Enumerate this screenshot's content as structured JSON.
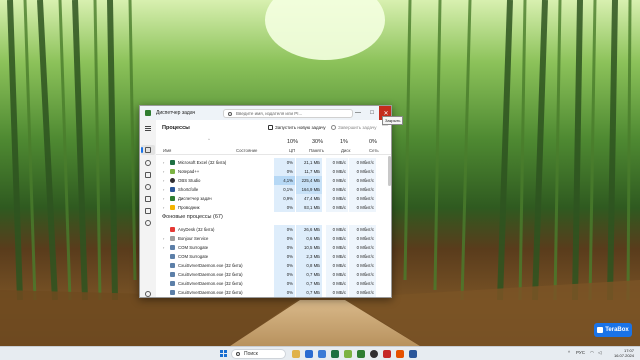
{
  "window": {
    "title": "Диспетчер задач",
    "search_placeholder": "Введите имя, издателя или PI...",
    "minimize": "—",
    "maximize": "□",
    "close": "✕",
    "close_tooltip": "Закрыть"
  },
  "toolbar": {
    "page_title": "Процессы",
    "run_task": "Запустить новую задачу",
    "end_task": "Завершить задачу",
    "more": "···"
  },
  "columns": {
    "name": "Имя",
    "status": "Состояние",
    "cpu_pct": "10%",
    "cpu": "ЦП",
    "mem_pct": "30%",
    "mem": "Память",
    "disk_pct": "1%",
    "disk": "Диск",
    "net_pct": "0%",
    "net": "Сеть"
  },
  "app_rows": [
    {
      "name": "Microsoft Excel (32 бита)",
      "cpu": "0%",
      "mem": "21,1 МБ",
      "disk": "0 МБ/с",
      "net": "0 Мбит/с",
      "icon_color": "#1d6f42"
    },
    {
      "name": "Notepad++",
      "cpu": "0%",
      "mem": "11,7 МБ",
      "disk": "0 МБ/с",
      "net": "0 Мбит/с",
      "icon_color": "#7cb342"
    },
    {
      "name": "OBS Studio",
      "cpu": "4,1%",
      "mem": "225,4 МБ",
      "disk": "0 МБ/с",
      "net": "0 Мбит/с",
      "icon_color": "#302e31"
    },
    {
      "name": "Shortcfolle",
      "cpu": "0,1%",
      "mem": "164,9 МБ",
      "disk": "0 МБ/с",
      "net": "0 Мбит/с",
      "icon_color": "#2b579a"
    },
    {
      "name": "Диспетчер задач",
      "cpu": "0,9%",
      "mem": "47,4 МБ",
      "disk": "0 МБ/с",
      "net": "0 Мбит/с",
      "icon_color": "#2e7d32"
    },
    {
      "name": "Проводник",
      "cpu": "0%",
      "mem": "93,1 МБ",
      "disk": "0 МБ/с",
      "net": "0 Мбит/с",
      "icon_color": "#f4b400"
    }
  ],
  "background_group": "Фоновые процессы (67)",
  "bg_rows": [
    {
      "name": "AnyDesk (32 бита)",
      "cpu": "0%",
      "mem": "26,6 МБ",
      "disk": "0 МБ/с",
      "net": "0 Мбит/с",
      "icon_color": "#e53935"
    },
    {
      "name": "Bonjour Service",
      "cpu": "0%",
      "mem": "0,6 МБ",
      "disk": "0 МБ/с",
      "net": "0 Мбит/с",
      "icon_color": "#9e9e9e"
    },
    {
      "name": "COM Surrogate",
      "cpu": "0%",
      "mem": "10,5 МБ",
      "disk": "0 МБ/с",
      "net": "0 Мбит/с",
      "icon_color": "#5c7fa8"
    },
    {
      "name": "COM Surrogate",
      "cpu": "0%",
      "mem": "2,3 МБ",
      "disk": "0 МБ/с",
      "net": "0 Мбит/с",
      "icon_color": "#5c7fa8"
    },
    {
      "name": "CxuiSvrverDaemon.exe (32 бита)",
      "cpu": "0%",
      "mem": "0,8 МБ",
      "disk": "0 МБ/с",
      "net": "0 Мбит/с",
      "icon_color": "#5c7fa8"
    },
    {
      "name": "CxuiSvrverDaemon.exe (32 бита)",
      "cpu": "0%",
      "mem": "0,7 МБ",
      "disk": "0 МБ/с",
      "net": "0 Мбит/с",
      "icon_color": "#5c7fa8"
    },
    {
      "name": "CxuiSvrverDaemon.exe (32 бита)",
      "cpu": "0%",
      "mem": "0,7 МБ",
      "disk": "0 МБ/с",
      "net": "0 Мбит/с",
      "icon_color": "#5c7fa8"
    },
    {
      "name": "CxuiSvrverDaemon.exe (32 бита)",
      "cpu": "0%",
      "mem": "0,7 МБ",
      "disk": "0 МБ/с",
      "net": "0 Мбит/с",
      "icon_color": "#5c7fa8"
    }
  ],
  "desktop": {
    "terabox_label": "TeraBox"
  },
  "taskbar": {
    "search_label": "Поиск",
    "lang": "РУС",
    "time": "17:07",
    "date": "16.07.2024"
  },
  "colors": {
    "accent": "#1a73e8",
    "close_red": "#c42b1c",
    "cpu_highlight": "#b6d8f5"
  }
}
